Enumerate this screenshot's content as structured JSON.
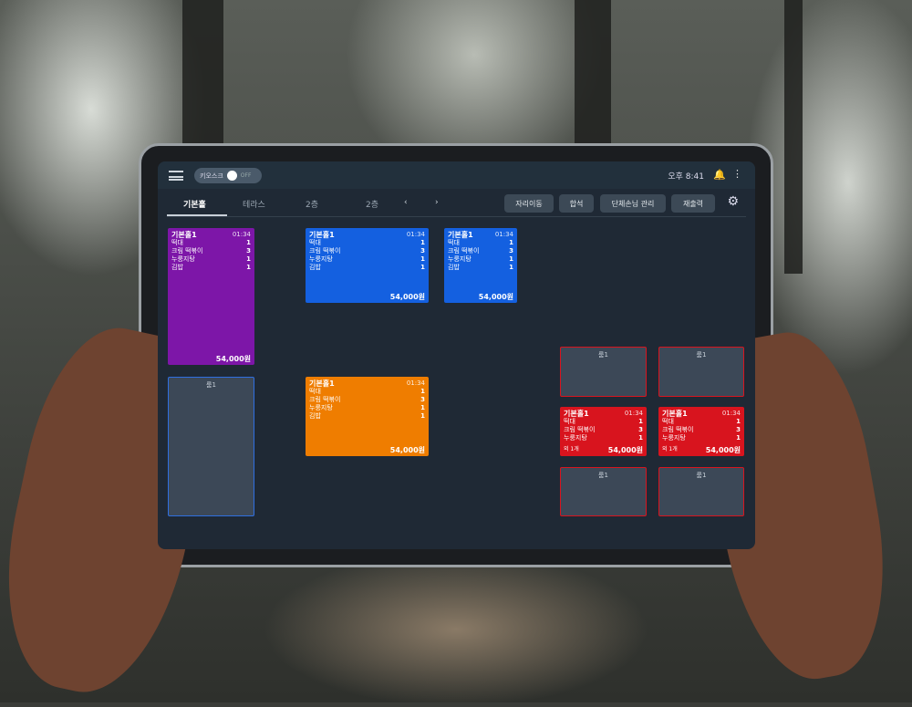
{
  "topbar": {
    "kiosk_label": "키오스크",
    "kiosk_state": "OFF",
    "time": "오후 8:41"
  },
  "tabs": [
    "기본홀",
    "테라스",
    "2층",
    "2층"
  ],
  "buttons": {
    "move_seat": "자리이동",
    "merge": "합석",
    "group": "단체손님 관리",
    "reprint": "재출력"
  },
  "colors": {
    "purple": "#7d16a8",
    "blue": "#1460e0",
    "orange": "#ef7d00",
    "red": "#d8141e",
    "empty": "#3c4857"
  },
  "order": {
    "table": "기본홀1",
    "elapsed": "01:34",
    "items": [
      {
        "name": "떡대",
        "qty": "1"
      },
      {
        "name": "크림 떡볶이",
        "qty": "3"
      },
      {
        "name": "누룽지탕",
        "qty": "1"
      },
      {
        "name": "김밥",
        "qty": "1"
      }
    ],
    "total": "54,000원",
    "extra": "외 1개"
  },
  "empty_table": "룸1"
}
